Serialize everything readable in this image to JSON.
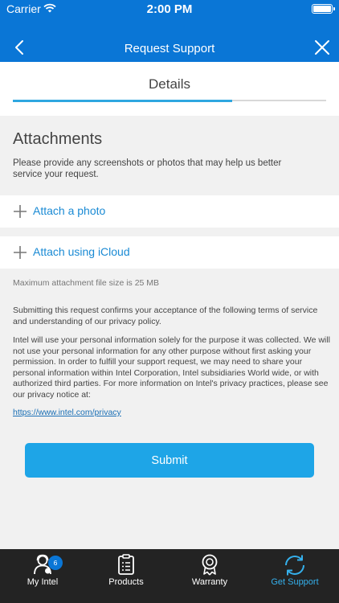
{
  "status_bar": {
    "carrier": "Carrier",
    "time": "2:00 PM"
  },
  "nav": {
    "title": "Request Support",
    "back_icon": "chevron-left-icon",
    "close_icon": "close-icon"
  },
  "tabs": {
    "current": "Details",
    "progress": 0.7
  },
  "attachments": {
    "title": "Attachments",
    "description": "Please provide any screenshots or photos that may help us better service your request.",
    "attach_photo": "Attach a photo",
    "attach_icloud": "Attach using iCloud",
    "max_size": "Maximum attachment file size is 25 MB"
  },
  "legal": {
    "terms": "Submitting this request confirms your acceptance of the following terms of service and understanding of our privacy policy.",
    "privacy": "Intel will use your personal information solely for the purpose it was collected. We will not use your personal information for any other purpose without first asking your permission. In order to fulfill your support request, we may need to share your personal information within Intel Corporation, Intel subsidiaries World wide, or with authorized third parties. For more information on Intel's privacy practices, please see our privacy notice at:",
    "link": "https://www.intel.com/privacy"
  },
  "submit_label": "Submit",
  "colors": {
    "header": "#0a76d6",
    "accent": "#1ea5e7",
    "tabbar": "#232323",
    "active_tab": "#35b0ec"
  },
  "tabbar": {
    "items": [
      {
        "label": "My Intel",
        "icon": "user-icon",
        "badge": "6"
      },
      {
        "label": "Products",
        "icon": "clipboard-icon"
      },
      {
        "label": "Warranty",
        "icon": "award-ribbon-icon"
      },
      {
        "label": "Get Support",
        "icon": "refresh-icon",
        "active": true
      }
    ]
  }
}
